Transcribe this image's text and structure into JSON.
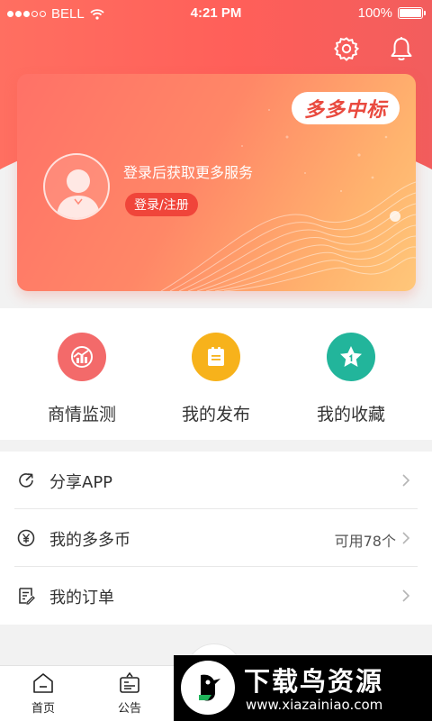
{
  "status_bar": {
    "carrier": "BELL",
    "time": "4:21 PM",
    "battery": "100%"
  },
  "header": {
    "settings_icon": "gear-icon",
    "notification_icon": "bell-icon"
  },
  "profile_card": {
    "brand": "多多中标",
    "login_hint": "登录后获取更多服务",
    "login_button": "登录/注册"
  },
  "quick_actions": [
    {
      "label": "商情监测",
      "icon": "chart-icon",
      "color": "#f36a6a"
    },
    {
      "label": "我的发布",
      "icon": "notepad-icon",
      "color": "#f7b21b"
    },
    {
      "label": "我的收藏",
      "icon": "star-icon",
      "color": "#22b59b"
    }
  ],
  "menu": [
    {
      "label": "分享APP",
      "value": "",
      "icon": "share-icon"
    },
    {
      "label": "我的多多币",
      "value": "可用78个",
      "icon": "yen-icon"
    },
    {
      "label": "我的订单",
      "value": "",
      "icon": "order-icon"
    }
  ],
  "bottom_nav": [
    {
      "label": "首页",
      "icon": "home-icon"
    },
    {
      "label": "公告",
      "icon": "announcement-icon"
    }
  ],
  "watermark": {
    "title": "下载鸟资源",
    "url": "www.xiazainiao.com"
  },
  "colors": {
    "accent": "#ff5f59",
    "login_button": "#f0453a"
  }
}
